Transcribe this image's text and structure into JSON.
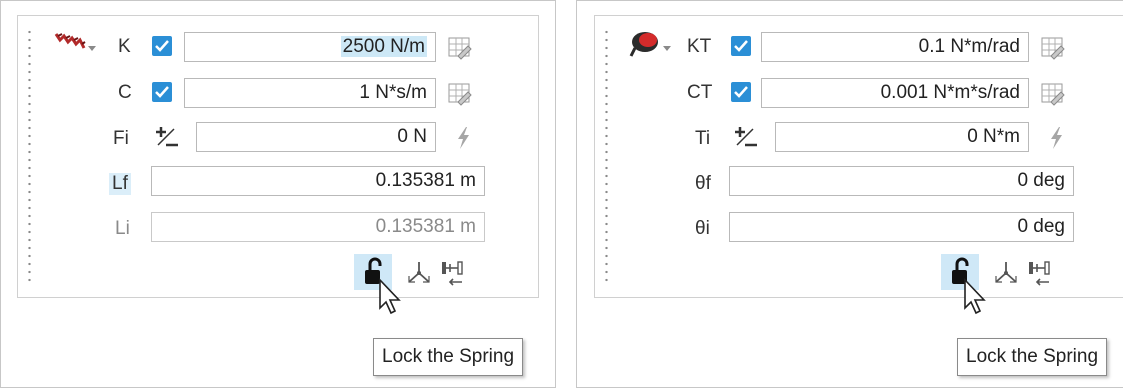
{
  "left": {
    "rows": [
      {
        "label": "K",
        "value": "2500 N/m",
        "checked": true
      },
      {
        "label": "C",
        "value": "1 N*s/m",
        "checked": true
      },
      {
        "label": "Fi",
        "value": "0 N"
      },
      {
        "label": "Lf",
        "value": "0.135381 m"
      },
      {
        "label": "Li",
        "value": "0.135381 m"
      }
    ],
    "tooltip": "Lock the Spring",
    "element_icon": "linear-spring-icon"
  },
  "right": {
    "rows": [
      {
        "label": "KT",
        "value": "0.1 N*m/rad",
        "checked": true
      },
      {
        "label": "CT",
        "value": "0.001 N*m*s/rad",
        "checked": true
      },
      {
        "label": "Ti",
        "value": "0 N*m"
      },
      {
        "label": "θf",
        "value": "0 deg"
      },
      {
        "label": "θi",
        "value": "0 deg"
      }
    ],
    "tooltip": "Lock the Spring",
    "element_icon": "torsion-spring-icon"
  },
  "colors": {
    "accent": "#2b8fd6",
    "highlight": "#cfe8f7"
  }
}
